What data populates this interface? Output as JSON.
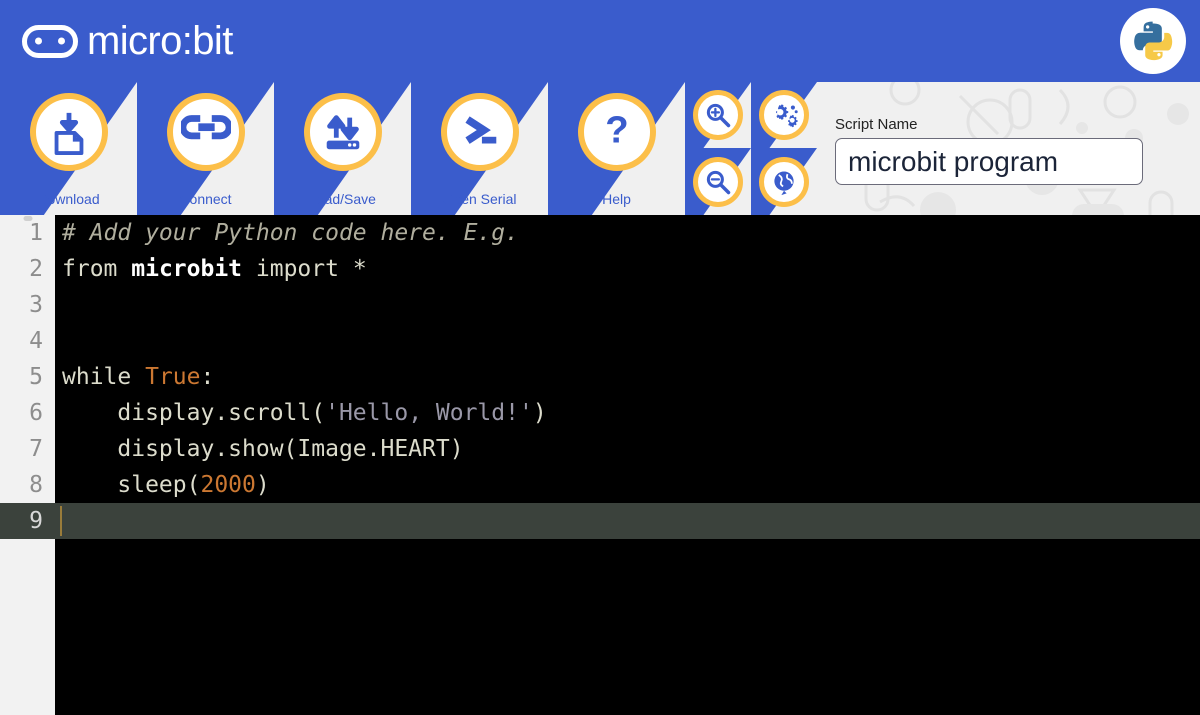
{
  "header": {
    "brand": "micro:bit",
    "logo_icon": "microbit-chip-icon",
    "python_badge_icon": "python-logo-icon"
  },
  "toolbar": {
    "buttons": [
      {
        "label": "Download",
        "icon": "download-to-file-icon"
      },
      {
        "label": "Connect",
        "icon": "link-connect-icon"
      },
      {
        "label": "Load/Save",
        "icon": "load-save-arrows-icon"
      },
      {
        "label": "Open Serial",
        "icon": "terminal-prompt-icon"
      },
      {
        "label": "Help",
        "icon": "question-mark-icon"
      }
    ],
    "small_buttons": [
      {
        "name": "zoom-in",
        "icon": "magnifier-plus-icon",
        "title": "Zoom In"
      },
      {
        "name": "settings",
        "icon": "gears-icon",
        "title": "Settings"
      },
      {
        "name": "zoom-out",
        "icon": "magnifier-minus-icon",
        "title": "Zoom Out"
      },
      {
        "name": "language",
        "icon": "globe-icon",
        "title": "Language"
      }
    ]
  },
  "script": {
    "label": "Script Name",
    "value": "microbit program",
    "placeholder": "Script Name"
  },
  "editor": {
    "line_numbers": [
      "1",
      "2",
      "3",
      "4",
      "5",
      "6",
      "7",
      "8",
      "9"
    ],
    "active_line": 9,
    "lines": [
      {
        "n": "1",
        "tokens": [
          {
            "t": "comment",
            "s": "# Add your Python code here. E.g."
          }
        ]
      },
      {
        "n": "2",
        "tokens": [
          {
            "t": "kw",
            "s": "from "
          },
          {
            "t": "bold",
            "s": "microbit"
          },
          {
            "t": "kw",
            "s": " import "
          },
          {
            "t": "plain",
            "s": "*"
          }
        ]
      },
      {
        "n": "3",
        "tokens": [
          {
            "t": "plain",
            "s": ""
          }
        ]
      },
      {
        "n": "4",
        "tokens": [
          {
            "t": "plain",
            "s": ""
          }
        ]
      },
      {
        "n": "5",
        "tokens": [
          {
            "t": "kw",
            "s": "while "
          },
          {
            "t": "const",
            "s": "True"
          },
          {
            "t": "plain",
            "s": ":"
          }
        ]
      },
      {
        "n": "6",
        "tokens": [
          {
            "t": "plain",
            "s": "    display.scroll("
          },
          {
            "t": "str",
            "s": "'Hello, World!'"
          },
          {
            "t": "plain",
            "s": ")"
          }
        ]
      },
      {
        "n": "7",
        "tokens": [
          {
            "t": "plain",
            "s": "    display.show(Image.HEART)"
          }
        ]
      },
      {
        "n": "8",
        "tokens": [
          {
            "t": "plain",
            "s": "    sleep("
          },
          {
            "t": "num",
            "s": "2000"
          },
          {
            "t": "plain",
            "s": ")"
          }
        ]
      },
      {
        "n": "9",
        "tokens": [
          {
            "t": "plain",
            "s": ""
          }
        ]
      }
    ]
  },
  "colors": {
    "brand_blue": "#3a5ccc",
    "accent_yellow": "#fcbf49",
    "toolbar_bg": "#f0f0f0",
    "editor_bg": "#000000",
    "gutter_bg": "#f2f2f2",
    "active_line_bg": "#3b423c",
    "python_blue": "#356f9e",
    "python_yellow": "#f6c948"
  }
}
